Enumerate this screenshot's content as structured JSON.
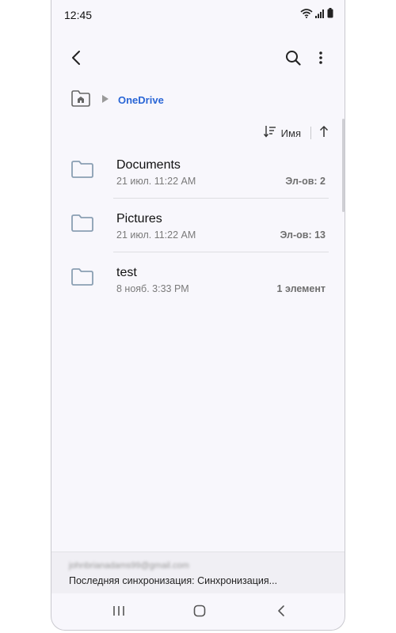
{
  "status_bar": {
    "time": "12:45",
    "icons": [
      "wifi-icon",
      "signal-icon",
      "battery-icon"
    ]
  },
  "app_bar": {
    "back_icon": "back-arrow-icon",
    "search_icon": "search-icon",
    "more_icon": "more-vert-icon"
  },
  "breadcrumb": {
    "home_icon": "home-folder-icon",
    "separator_icon": "triangle-right-icon",
    "current": "OneDrive"
  },
  "sort": {
    "icon": "sort-icon",
    "label": "Имя",
    "direction_icon": "arrow-up-icon"
  },
  "files": [
    {
      "name": "Documents",
      "date": "21 июл. 11:22 AM",
      "count": "Эл-ов: 2",
      "icon": "folder-icon"
    },
    {
      "name": "Pictures",
      "date": "21 июл. 11:22 AM",
      "count": "Эл-ов: 13",
      "icon": "folder-icon"
    },
    {
      "name": "test",
      "date": "8 нояб. 3:33 PM",
      "count": "1 элемент",
      "icon": "folder-icon"
    }
  ],
  "footer": {
    "email": "johnbrianadams99@gmail.com",
    "sync_status": "Последняя синхронизация: Синхронизация..."
  },
  "nav_bar": {
    "recents_icon": "recents-icon",
    "home_icon": "home-icon",
    "back_icon": "nav-back-icon"
  },
  "colors": {
    "accent": "#2a66d6",
    "folder": "#8a9fb3",
    "background": "#f8f7fc"
  }
}
